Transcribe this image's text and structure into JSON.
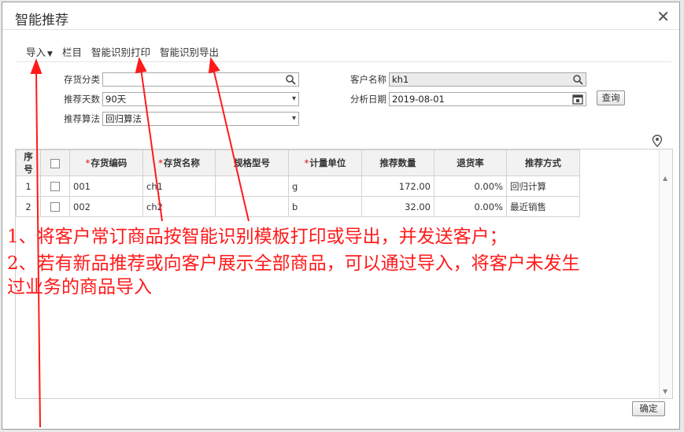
{
  "dialog": {
    "title": "智能推荐",
    "close_glyph": "✕"
  },
  "toolbar": {
    "import_label": "导入",
    "columns_label": "栏目",
    "smart_print_label": "智能识别打印",
    "smart_export_label": "智能识别导出"
  },
  "form": {
    "category_label": "存货分类",
    "category_value": "",
    "days_label": "推荐天数",
    "days_value": "90天",
    "algo_label": "推荐算法",
    "algo_value": "回归算法",
    "customer_label": "客户名称",
    "customer_value": "kh1",
    "date_label": "分析日期",
    "date_value": "2019-08-01",
    "query_label": "查询"
  },
  "table": {
    "headers": {
      "seq": "序号",
      "code": "存货编码",
      "name": "存货名称",
      "spec": "规格型号",
      "unit": "计量单位",
      "qty": "推荐数量",
      "return_rate": "退货率",
      "method": "推荐方式"
    },
    "rows": [
      {
        "seq": "1",
        "code": "001",
        "name": "ch1",
        "spec": "",
        "unit": "g",
        "qty": "172.00",
        "return_rate": "0.00%",
        "method": "回归计算"
      },
      {
        "seq": "2",
        "code": "002",
        "name": "ch2",
        "spec": "",
        "unit": "b",
        "qty": "32.00",
        "return_rate": "0.00%",
        "method": "最近销售"
      }
    ]
  },
  "footer": {
    "confirm_label": "确定"
  },
  "annotation": {
    "line1": "1、将客户常订商品按智能识别模板打印或导出，并发送客户；",
    "line2": "2、若有新品推荐或向客户展示全部商品，可以通过导入，将客户未发生",
    "line3": "过业务的商品导入",
    "color": "#ff1a1a"
  }
}
